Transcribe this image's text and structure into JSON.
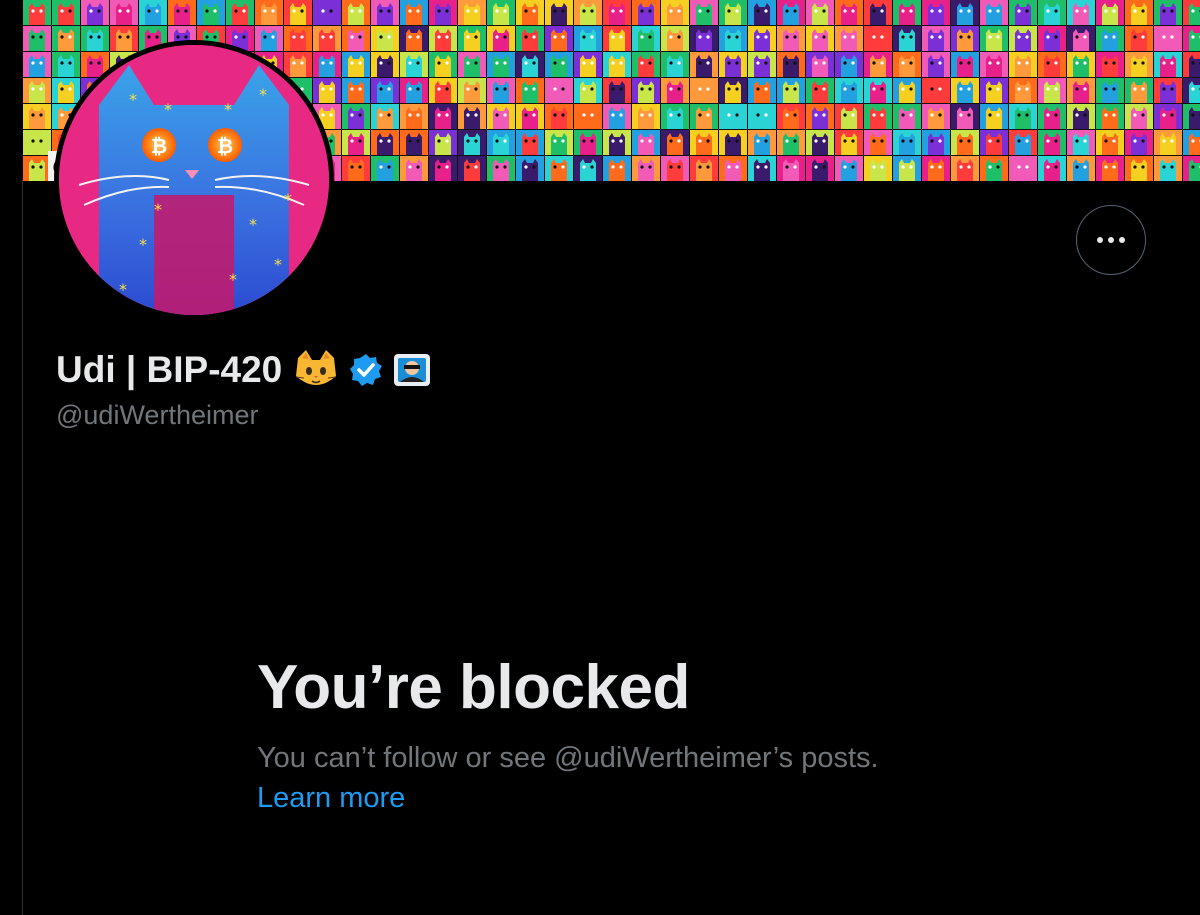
{
  "profile": {
    "display_name": "Udi | BIP-420",
    "name_emoji": "cat-face-emoji",
    "verified": true,
    "extra_badge": "affiliate-badge",
    "handle": "@udiWertheimer"
  },
  "banner": {
    "corner_badge": "@",
    "palette": [
      "#e8208a",
      "#22a0e0",
      "#ff6b1a",
      "#f5d020",
      "#7b2fd6",
      "#1fbf6a",
      "#ff3b3b",
      "#f25ab8",
      "#2bd4d4",
      "#3a1a6b",
      "#c8e64a",
      "#ff9a3c"
    ]
  },
  "blocked": {
    "title": "You’re blocked",
    "description": "You can’t follow or see @udiWertheimer’s posts.",
    "learn_more": "Learn more"
  },
  "colors": {
    "background": "#000000",
    "primary_text": "#e7e9ea",
    "secondary_text": "#71767b",
    "link": "#1d9bf0",
    "verified": "#1d9bf0"
  }
}
